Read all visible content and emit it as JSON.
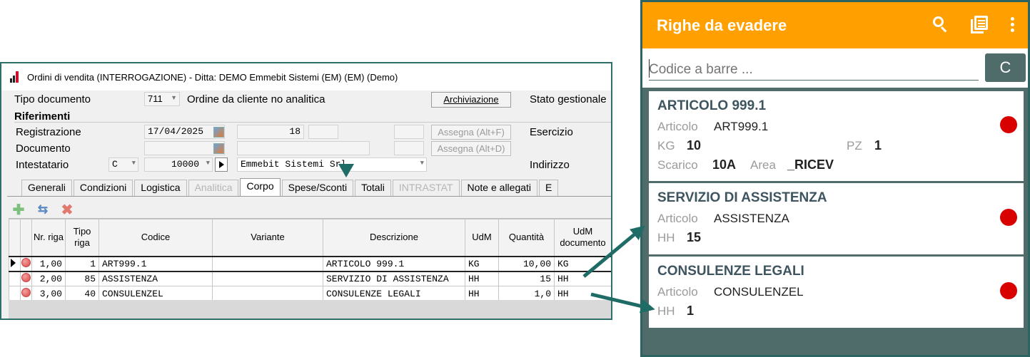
{
  "desktop": {
    "window_title": "Ordini di vendita (INTERROGAZIONE)  - Ditta: DEMO Emmebit Sistemi (EM) (EM)  (Demo)",
    "tipo_documento_label": "Tipo documento",
    "tipo_documento_code": "711",
    "tipo_documento_desc": "Ordine da cliente no analitica",
    "archiviazione_label": "Archiviazione",
    "stato_gestionale_label": "Stato gestionale",
    "riferimenti_label": "Riferimenti",
    "registrazione_label": "Registrazione",
    "registrazione_date": "17/04/2025",
    "registrazione_num": "18",
    "documento_label": "Documento",
    "intestatario_label": "Intestatario",
    "intestatario_type": "C",
    "intestatario_code": "10000",
    "intestatario_name": "Emmebit Sistemi Srl",
    "assegna1_label": "Assegna (Alt+F)",
    "assegna2_label": "Assegna (Alt+D)",
    "esercizio_label": "Esercizio",
    "indirizzo_label": "Indirizzo",
    "tabs": [
      {
        "label": "Generali"
      },
      {
        "label": "Condizioni"
      },
      {
        "label": "Logistica"
      },
      {
        "label": "Analitica"
      },
      {
        "label": "Corpo"
      },
      {
        "label": "Spese/Sconti"
      },
      {
        "label": "Totali"
      },
      {
        "label": "INTRASTAT"
      },
      {
        "label": "Note e allegati"
      },
      {
        "label": "E"
      }
    ],
    "columns": {
      "nr_riga": "Nr. riga",
      "tipo_riga": "Tipo riga",
      "codice": "Codice",
      "variante": "Variante",
      "descrizione": "Descrizione",
      "udm": "UdM",
      "quantita": "Quantità",
      "udm_documento": "UdM documento"
    },
    "rows": [
      {
        "nr": "1,00",
        "tipo": "1",
        "codice": "ART999.1",
        "variante": "",
        "descrizione": "ARTICOLO 999.1",
        "udm": "KG",
        "quantita": "10,00",
        "udm_doc": "KG"
      },
      {
        "nr": "2,00",
        "tipo": "85",
        "codice": "ASSISTENZA",
        "variante": "",
        "descrizione": "SERVIZIO DI ASSISTENZA",
        "udm": "HH",
        "quantita": "15",
        "udm_doc": "HH"
      },
      {
        "nr": "3,00",
        "tipo": "40",
        "codice": "CONSULENZEL",
        "variante": "",
        "descrizione": "CONSULENZE LEGALI",
        "udm": "HH",
        "quantita": "1,0",
        "udm_doc": "HH"
      }
    ]
  },
  "mobile": {
    "title": "Righe da evadere",
    "barcode_placeholder": "Codice a barre ...",
    "clear_button": "C",
    "status_color": "#d90000",
    "accent_color": "#ffa000",
    "cards": [
      {
        "title": "ARTICOLO 999.1",
        "articolo_label": "Articolo",
        "articolo": "ART999.1",
        "um1_label": "KG",
        "um1_value": "10",
        "um2_label": "PZ",
        "um2_value": "1",
        "scarico_label": "Scarico",
        "scarico": "10A",
        "area_label": "Area",
        "area": "_RICEV"
      },
      {
        "title": "SERVIZIO DI ASSISTENZA",
        "articolo_label": "Articolo",
        "articolo": "ASSISTENZA",
        "um1_label": "HH",
        "um1_value": "15"
      },
      {
        "title": "CONSULENZE LEGALI",
        "articolo_label": "Articolo",
        "articolo": "CONSULENZEL",
        "um1_label": "HH",
        "um1_value": "1"
      }
    ]
  }
}
